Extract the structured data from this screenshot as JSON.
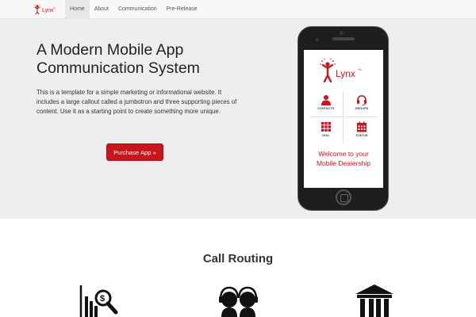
{
  "brand": {
    "name": "Lynx",
    "trademark": "TM"
  },
  "nav": {
    "items": [
      {
        "label": "Home",
        "active": true
      },
      {
        "label": "About",
        "active": false
      },
      {
        "label": "Communication",
        "active": false
      },
      {
        "label": "Pre-Release",
        "active": false
      }
    ]
  },
  "jumbotron": {
    "title": "A Modern Mobile App Communication System",
    "text": "This is a template for a simple marketing or informational website. It includes a large callout called a jumbotron and three supporting pieces of content. Use it as a starting point to create something more unique.",
    "button_label": "Purchase App »"
  },
  "phone": {
    "app_name": "Lynx",
    "tiles": [
      {
        "label": "CONTACTS",
        "icon": "contacts-icon"
      },
      {
        "label": "GROUPS",
        "icon": "headset-icon"
      },
      {
        "label": "DIAL",
        "icon": "dialpad-icon"
      },
      {
        "label": "STATUS",
        "icon": "calendar-icon"
      }
    ],
    "welcome_line1": "Welcome to your",
    "welcome_line2": "Mobile Dealership"
  },
  "section": {
    "title": "Call Routing",
    "icons": [
      "chart-search-icon",
      "people-headset-icon",
      "bank-icon"
    ]
  },
  "colors": {
    "accent": "#c9161c",
    "jumbotron_bg": "#eeeeee",
    "navbar_bg": "#f8f8f8"
  }
}
